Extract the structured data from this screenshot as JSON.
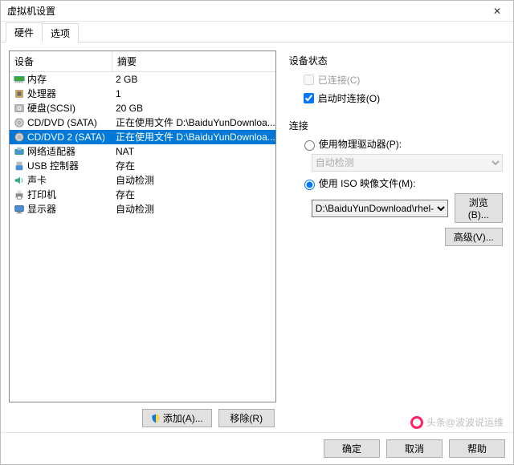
{
  "title": "虚拟机设置",
  "tabs": {
    "hardware": "硬件",
    "options": "选项"
  },
  "columns": {
    "device": "设备",
    "summary": "摘要"
  },
  "devices": [
    {
      "icon": "memory",
      "name": "内存",
      "summary": "2 GB"
    },
    {
      "icon": "cpu",
      "name": "处理器",
      "summary": "1"
    },
    {
      "icon": "disk",
      "name": "硬盘(SCSI)",
      "summary": "20 GB"
    },
    {
      "icon": "cd",
      "name": "CD/DVD (SATA)",
      "summary": "正在使用文件 D:\\BaiduYunDownloa..."
    },
    {
      "icon": "cd",
      "name": "CD/DVD 2 (SATA)",
      "summary": "正在使用文件 D:\\BaiduYunDownloa..."
    },
    {
      "icon": "net",
      "name": "网络适配器",
      "summary": "NAT"
    },
    {
      "icon": "usb",
      "name": "USB 控制器",
      "summary": "存在"
    },
    {
      "icon": "sound",
      "name": "声卡",
      "summary": "自动检测"
    },
    {
      "icon": "printer",
      "name": "打印机",
      "summary": "存在"
    },
    {
      "icon": "display",
      "name": "显示器",
      "summary": "自动检测"
    }
  ],
  "selectedIndex": 4,
  "leftButtons": {
    "add": "添加(A)...",
    "remove": "移除(R)"
  },
  "right": {
    "statusTitle": "设备状态",
    "connected": "已连接(C)",
    "connectOnPower": "启动时连接(O)",
    "connectionTitle": "连接",
    "usePhysical": "使用物理驱动器(P):",
    "physicalCombo": "自动检测",
    "useIso": "使用 ISO 映像文件(M):",
    "isoPath": "D:\\BaiduYunDownload\\rhel-",
    "browse": "浏览(B)...",
    "advanced": "高级(V)..."
  },
  "bottom": {
    "ok": "确定",
    "cancel": "取消",
    "help": "帮助"
  },
  "watermark": "头条@波波说运维"
}
